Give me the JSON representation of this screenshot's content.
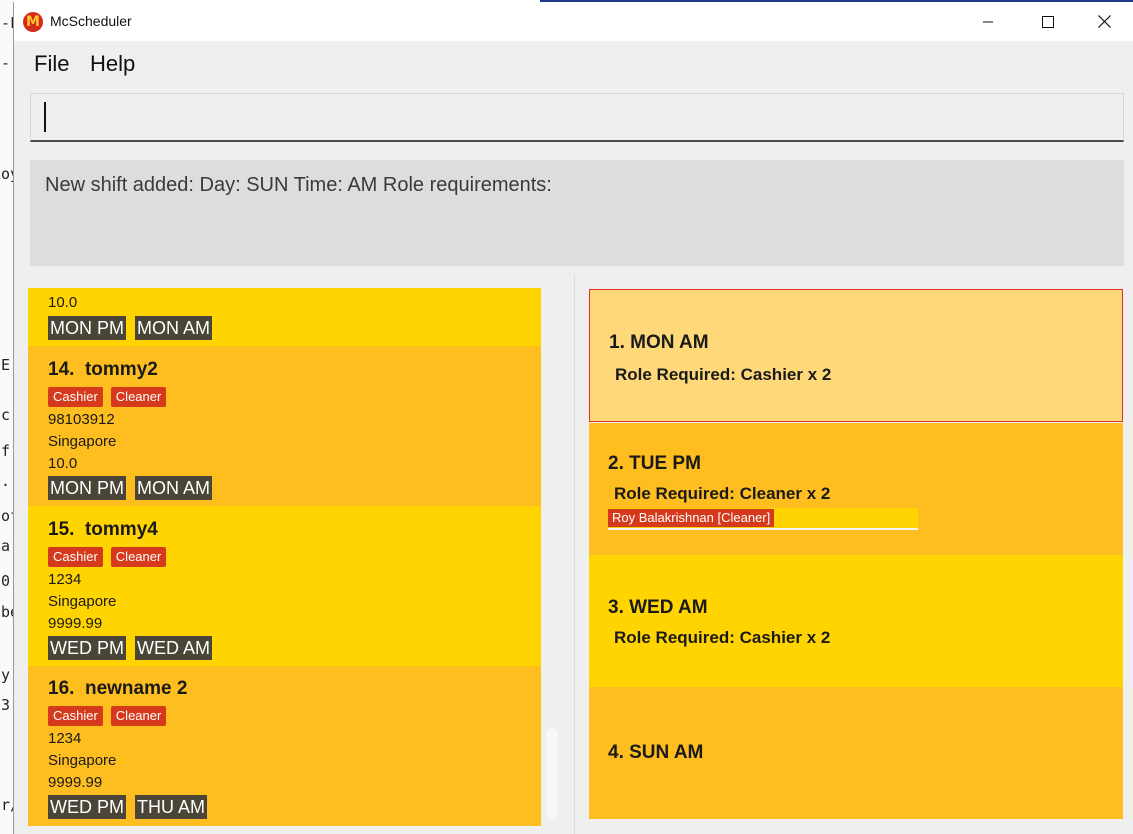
{
  "background_window": {
    "fragments": [
      "-F",
      "- N",
      "oy",
      "E",
      "c t",
      "f",
      ".",
      "of",
      "a",
      "0",
      "be",
      "y",
      "3,",
      "r/"
    ]
  },
  "window": {
    "title": "McScheduler",
    "logo_glyph": "M",
    "minimize_icon": "minimize-icon",
    "maximize_icon": "maximize-icon",
    "close_icon": "close-icon"
  },
  "menu": {
    "file": "File",
    "help": "Help"
  },
  "command_box": {
    "value": ""
  },
  "result": {
    "text": "New shift added:  Day: SUN Time: AM Role requirements:"
  },
  "persons": [
    {
      "index": "",
      "name": "",
      "roles": [],
      "phone": "",
      "address": "",
      "pay": "10.0",
      "availability": [
        "MON PM",
        "MON AM"
      ]
    },
    {
      "index": "14.",
      "name": "tommy2",
      "roles": [
        "Cashier",
        "Cleaner"
      ],
      "phone": "98103912",
      "address": "Singapore",
      "pay": "10.0",
      "availability": [
        "MON PM",
        "MON AM"
      ]
    },
    {
      "index": "15.",
      "name": "tommy4",
      "roles": [
        "Cashier",
        "Cleaner"
      ],
      "phone": "1234",
      "address": "Singapore",
      "pay": "9999.99",
      "availability": [
        "WED PM",
        "WED AM"
      ]
    },
    {
      "index": "16.",
      "name": "newname 2",
      "roles": [
        "Cashier",
        "Cleaner"
      ],
      "phone": "1234",
      "address": "Singapore",
      "pay": "9999.99",
      "availability": [
        "WED PM",
        "THU AM"
      ]
    }
  ],
  "shifts": [
    {
      "title": "1.  MON AM",
      "requirement": "Role Required: Cashier x 2",
      "assigned": [],
      "selected": true
    },
    {
      "title": "2.  TUE PM",
      "requirement": "Role Required: Cleaner x 2",
      "assigned": [
        "Roy Balakrishnan [Cleaner]"
      ],
      "selected": false
    },
    {
      "title": "3.  WED AM",
      "requirement": "Role Required: Cashier x 2",
      "assigned": [],
      "selected": false
    },
    {
      "title": "4.  SUN AM",
      "requirement": "",
      "assigned": [],
      "selected": false
    }
  ],
  "colors": {
    "card_yellow": "#ffd400",
    "card_amber": "#ffbe1f",
    "selected_card": "#ffd87a",
    "selected_border": "#e0302a",
    "role_tag": "#d43a1b",
    "availability_tag": "#4a4536",
    "logo_red": "#d52b1e",
    "logo_gold": "#ffc72c"
  }
}
